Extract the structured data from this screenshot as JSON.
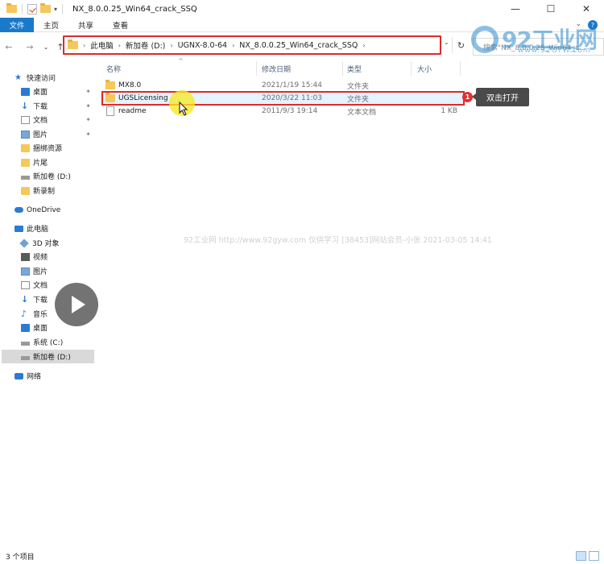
{
  "window": {
    "title": "NX_8.0.0.25_Win64_crack_SSQ",
    "minimize": "—",
    "maximize": "☐",
    "close": "✕"
  },
  "ribbon": {
    "tabs": [
      "文件",
      "主页",
      "共享",
      "查看"
    ]
  },
  "address": {
    "crumbs": [
      "此电脑",
      "新加卷 (D:)",
      "UGNX-8.0-64",
      "NX_8.0.0.25_Win64_crack_SSQ"
    ],
    "search_placeholder": "搜索\"NX_8.0.0.25_Win64_c..."
  },
  "watermark": {
    "logo_text": "92工业网",
    "logo_url": "www.92GYW.com",
    "overlay": "92工业网 http://www.92gyw.com 仅供学习 [38453]网站会员-小张 2021-03-05 14:41"
  },
  "sidebar": {
    "items": [
      {
        "label": "快速访问",
        "icon": "star-icon"
      },
      {
        "label": "桌面",
        "icon": "desktop-icon",
        "pinned": true
      },
      {
        "label": "下载",
        "icon": "download-icon",
        "pinned": true
      },
      {
        "label": "文档",
        "icon": "document-icon",
        "pinned": true
      },
      {
        "label": "图片",
        "icon": "picture-icon",
        "pinned": true
      },
      {
        "label": "捆绑资源",
        "icon": "folder-icon"
      },
      {
        "label": "片尾",
        "icon": "folder-icon"
      },
      {
        "label": "新加卷 (D:)",
        "icon": "drive-icon"
      },
      {
        "label": "新录制",
        "icon": "folder-icon"
      },
      {
        "label": "OneDrive",
        "icon": "cloud-icon"
      },
      {
        "label": "此电脑",
        "icon": "computer-icon"
      },
      {
        "label": "3D 对象",
        "icon": "3d-objects-icon"
      },
      {
        "label": "视频",
        "icon": "video-icon"
      },
      {
        "label": "图片",
        "icon": "picture-icon"
      },
      {
        "label": "文档",
        "icon": "document-icon"
      },
      {
        "label": "下载",
        "icon": "download-icon"
      },
      {
        "label": "音乐",
        "icon": "music-icon"
      },
      {
        "label": "桌面",
        "icon": "desktop-icon"
      },
      {
        "label": "系统 (C:)",
        "icon": "drive-icon"
      },
      {
        "label": "新加卷 (D:)",
        "icon": "drive-icon",
        "selected": true
      },
      {
        "label": "网络",
        "icon": "network-icon"
      }
    ]
  },
  "list": {
    "columns": [
      "名称",
      "修改日期",
      "类型",
      "大小"
    ],
    "rows": [
      {
        "name": "MX8.0",
        "date": "2021/1/19 15:44",
        "type": "文件夹",
        "size": ""
      },
      {
        "name": "UGSLicensing",
        "date": "2020/3/22 11:03",
        "type": "文件夹",
        "size": ""
      },
      {
        "name": "readme",
        "date": "2011/9/3 19:14",
        "type": "文本文档",
        "size": "1 KB"
      }
    ]
  },
  "annotation": {
    "badge": "1",
    "callout": "双击打开"
  },
  "status": {
    "count": "3 个项目"
  }
}
